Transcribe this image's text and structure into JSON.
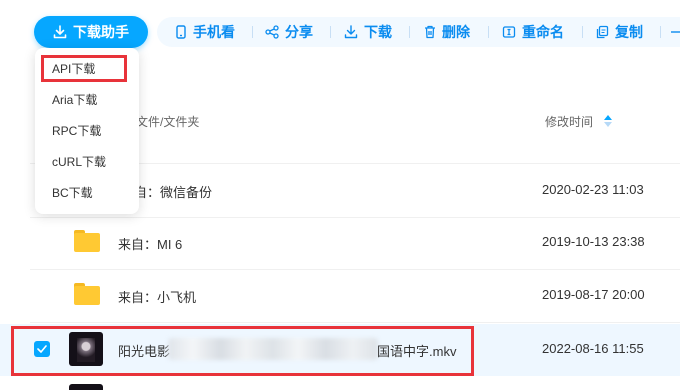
{
  "toolbar": {
    "download_helper_label": "下载助手",
    "buttons": [
      {
        "label": "手机看",
        "icon": "phone-icon"
      },
      {
        "label": "分享",
        "icon": "share-icon"
      },
      {
        "label": "下载",
        "icon": "download-icon"
      },
      {
        "label": "删除",
        "icon": "trash-icon"
      },
      {
        "label": "重命名",
        "icon": "rename-icon"
      },
      {
        "label": "复制",
        "icon": "copy-icon"
      }
    ]
  },
  "dropdown": {
    "items": [
      "API下载",
      "Aria下载",
      "RPC下载",
      "cURL下载",
      "BC下载"
    ],
    "highlighted_item": "API下载"
  },
  "table": {
    "columns": {
      "name": "文件/文件夹",
      "modified": "修改时间"
    },
    "rows": [
      {
        "name_visible": "自：微信备份",
        "modified": "2020-02-23 11:03",
        "type": "folder"
      },
      {
        "name": "来自：MI 6",
        "modified": "2019-10-13 23:38",
        "type": "folder"
      },
      {
        "name": "来自：小飞机",
        "modified": "2019-08-17 20:00",
        "type": "folder"
      },
      {
        "name_prefix": "阳光电影",
        "name_suffix": "国语中字.mkv",
        "modified": "2022-08-16 11:55",
        "type": "video",
        "selected": true
      }
    ]
  },
  "colors": {
    "accent": "#06a7ff",
    "toolbar_text": "#0a8cf0",
    "highlight": "#e8333a",
    "folder": "#ffc933"
  }
}
